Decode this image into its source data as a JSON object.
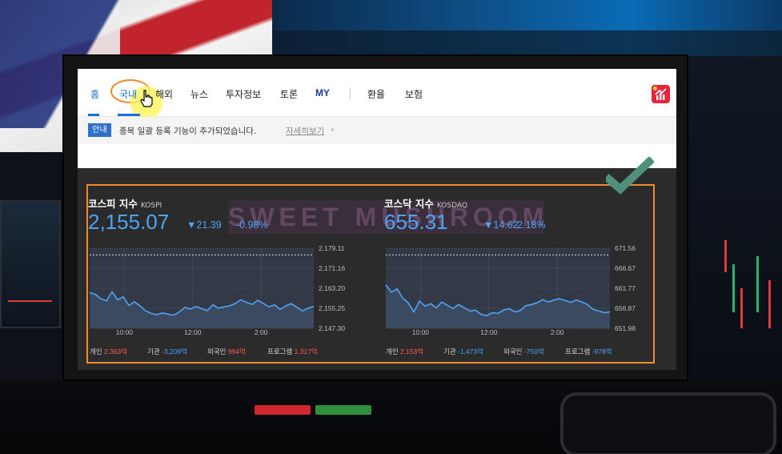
{
  "nav": {
    "items": [
      "홈",
      "국내",
      "해외",
      "뉴스",
      "투자정보",
      "토론",
      "MY",
      "환율",
      "보험"
    ]
  },
  "notice": {
    "badge": "안내",
    "text": "종목 일괄 등록 기능이 추가되었습니다.",
    "link": "자세히보기"
  },
  "watermark": "SWEET MUSHROOM",
  "colors": {
    "accent": "#4fa3f7",
    "highlight": "#f08a2c",
    "positive": "#ff5a5a",
    "check": "#4e8f7e"
  },
  "kospi": {
    "name": "코스피 지수",
    "name_en": "KOSPI",
    "value": "2,155.07",
    "change": "▼21.39",
    "rate": "-0.98%",
    "flows": [
      {
        "label": "개인",
        "value": "2,363억",
        "tone": "red"
      },
      {
        "label": "기관",
        "value": "-3,209억",
        "tone": "blue"
      },
      {
        "label": "외국인",
        "value": "994억",
        "tone": "red"
      },
      {
        "label": "프로그램",
        "value": "1,317억",
        "tone": "red"
      }
    ]
  },
  "kosdaq": {
    "name": "코스닥 지수",
    "name_en": "KOSDAQ",
    "value": "655.31",
    "change": "▼14.62",
    "rate": "-2.18%",
    "flows": [
      {
        "label": "개인",
        "value": "2,153억",
        "tone": "red"
      },
      {
        "label": "기관",
        "value": "-1,473억",
        "tone": "blue"
      },
      {
        "label": "외국인",
        "value": "-750억",
        "tone": "blue"
      },
      {
        "label": "프로그램",
        "value": "-978억",
        "tone": "blue"
      }
    ]
  },
  "chart_data": [
    {
      "type": "area",
      "series_name": "",
      "x_ticks": [
        "10:00",
        "12:00",
        "2:00"
      ],
      "y_ticks": [
        "2,179.11",
        "2,171.16",
        "2,163.20",
        "2,155.25",
        "2,147.30"
      ],
      "ylim": [
        2147.3,
        2179.11
      ],
      "reference": 2176.46,
      "x": [
        0,
        1,
        2,
        3,
        4,
        5,
        6,
        7,
        8,
        9,
        10,
        11,
        12,
        13,
        14,
        15,
        16,
        17,
        18,
        19,
        20,
        21,
        22,
        23,
        24,
        25,
        26,
        27,
        28,
        29,
        30,
        31,
        32,
        33,
        34,
        35,
        36,
        37,
        38,
        39,
        40
      ],
      "values": [
        2161.5,
        2160.8,
        2159.0,
        2158.2,
        2161.8,
        2158.6,
        2159.8,
        2156.4,
        2157.8,
        2156.2,
        2154.2,
        2153.2,
        2152.7,
        2153.4,
        2152.9,
        2152.5,
        2153.8,
        2155.6,
        2154.9,
        2156.0,
        2155.1,
        2154.3,
        2156.6,
        2155.3,
        2155.8,
        2156.2,
        2157.2,
        2158.6,
        2157.6,
        2156.8,
        2158.4,
        2157.2,
        2155.8,
        2156.6,
        2154.8,
        2156.2,
        2157.1,
        2155.6,
        2154.2,
        2155.3,
        2156.0
      ]
    },
    {
      "type": "area",
      "series_name": "",
      "x_ticks": [
        "10:00",
        "12:00",
        "2:00"
      ],
      "y_ticks": [
        "671.56",
        "666.67",
        "661.77",
        "656.87",
        "651.98"
      ],
      "ylim": [
        651.98,
        671.56
      ],
      "reference": 669.93,
      "x": [
        0,
        1,
        2,
        3,
        4,
        5,
        6,
        7,
        8,
        9,
        10,
        11,
        12,
        13,
        14,
        15,
        16,
        17,
        18,
        19,
        20,
        21,
        22,
        23,
        24,
        25,
        26,
        27,
        28,
        29,
        30,
        31,
        32,
        33,
        34,
        35,
        36,
        37,
        38,
        39,
        40
      ],
      "values": [
        662.6,
        660.8,
        661.6,
        659.4,
        658.2,
        656.0,
        658.6,
        657.4,
        658.0,
        657.0,
        658.4,
        657.6,
        656.8,
        657.8,
        657.0,
        656.2,
        656.4,
        655.4,
        655.1,
        655.8,
        655.6,
        656.4,
        656.8,
        656.0,
        656.3,
        657.5,
        657.8,
        658.2,
        659.0,
        658.4,
        658.9,
        659.2,
        658.8,
        658.3,
        658.9,
        658.4,
        657.8,
        656.6,
        656.2,
        655.8,
        656.0
      ]
    }
  ]
}
